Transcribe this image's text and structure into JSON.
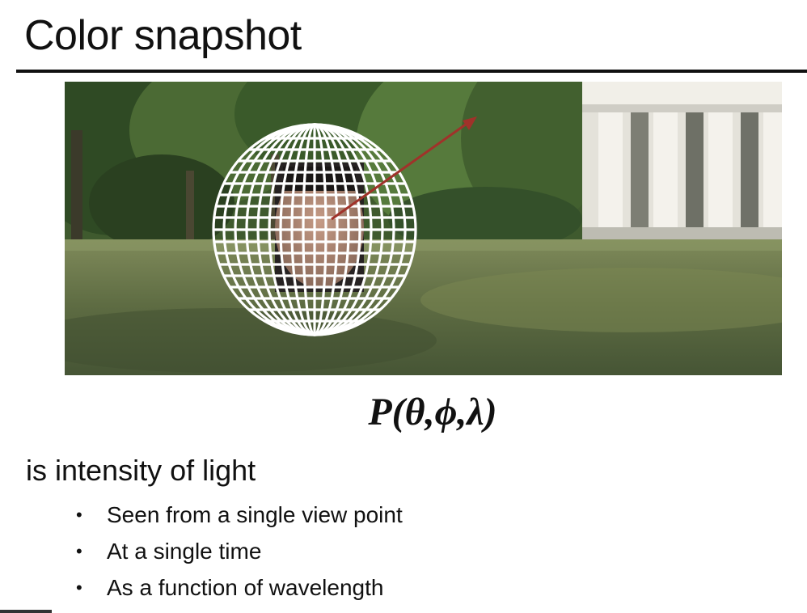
{
  "slide": {
    "title": "Color snapshot",
    "formula": "P(θ,ϕ,λ)",
    "lead": "is intensity of light",
    "bullets": [
      "Seen from a single view point",
      "At a single time",
      "As a function of wavelength"
    ]
  },
  "photo": {
    "description_icon": "plenoptic-sphere-photo",
    "colors": {
      "grass": "#5f7046",
      "trees": "#3e5a2c",
      "building": "#e8e6df",
      "arrow": "#a0322a",
      "grid": "#ffffff"
    }
  }
}
